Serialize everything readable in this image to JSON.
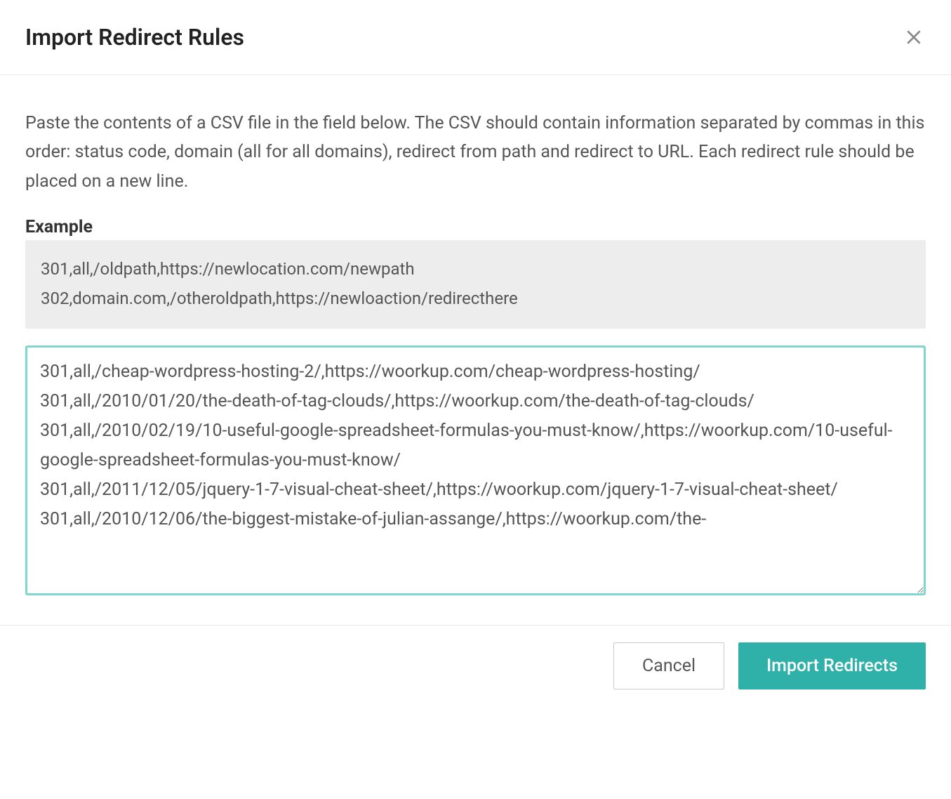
{
  "modal": {
    "title": "Import Redirect Rules",
    "instructions": "Paste the contents of a CSV file in the field below. The CSV should contain information separated by commas in this order: status code, domain (all for all domains), redirect from path and redirect to URL. Each redirect rule should be placed on a new line.",
    "example_label": "Example",
    "example_lines": [
      "301,all,/oldpath,https://newlocation.com/newpath",
      "302,domain.com,/otheroldpath,https://newloaction/redirecthere"
    ],
    "textarea_value": "301,all,/cheap-wordpress-hosting-2/,https://woorkup.com/cheap-wordpress-hosting/\n301,all,/2010/01/20/the-death-of-tag-clouds/,https://woorkup.com/the-death-of-tag-clouds/\n301,all,/2010/02/19/10-useful-google-spreadsheet-formulas-you-must-know/,https://woorkup.com/10-useful-google-spreadsheet-formulas-you-must-know/\n301,all,/2011/12/05/jquery-1-7-visual-cheat-sheet/,https://woorkup.com/jquery-1-7-visual-cheat-sheet/\n301,all,/2010/12/06/the-biggest-mistake-of-julian-assange/,https://woorkup.com/the-",
    "footer": {
      "cancel_label": "Cancel",
      "import_label": "Import Redirects"
    }
  }
}
